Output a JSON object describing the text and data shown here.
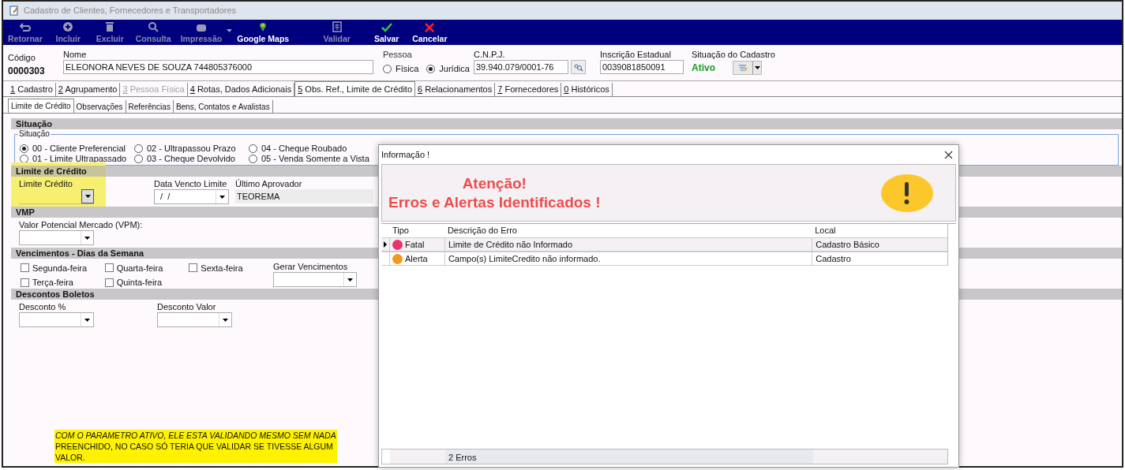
{
  "window": {
    "title": "Cadastro de Clientes, Fornecedores e Transportadores"
  },
  "toolbar": [
    {
      "label": "Retornar",
      "disabled": true
    },
    {
      "label": "Incluir",
      "disabled": true
    },
    {
      "label": "Excluir",
      "disabled": true
    },
    {
      "label": "Consulta",
      "disabled": true
    },
    {
      "label": "Impressão",
      "disabled": true,
      "dropdown": true
    },
    {
      "label": "Google Maps",
      "disabled": false
    },
    {
      "label": "Validar",
      "disabled": true
    },
    {
      "label": "Salvar",
      "disabled": false
    },
    {
      "label": "Cancelar",
      "disabled": false
    }
  ],
  "header": {
    "codigo": {
      "label": "Código",
      "value": "0000303"
    },
    "nome": {
      "label": "Nome",
      "value": "ELEONORA NEVES DE SOUZA 744805376000"
    },
    "pessoa": {
      "label": "Pessoa",
      "options": [
        {
          "label": "Física",
          "selected": false
        },
        {
          "label": "Jurídica",
          "selected": true
        }
      ]
    },
    "cnpj": {
      "label": "C.N.P.J.",
      "value": "39.940.079/0001-76"
    },
    "inscricao": {
      "label": "Inscrição Estadual",
      "value": "0039081850091"
    },
    "situacao": {
      "label": "Situação do Cadastro",
      "value": "Ativo"
    }
  },
  "tabs": [
    {
      "label": "1 Cadastro",
      "selected": false,
      "disabled": false
    },
    {
      "label": "2 Agrupamento",
      "selected": false,
      "disabled": false
    },
    {
      "label": "3 Pessoa Física",
      "selected": false,
      "disabled": true
    },
    {
      "label": "4 Rotas, Dados Adicionais",
      "selected": false,
      "disabled": false
    },
    {
      "label": "5 Obs. Ref., Limite de Crédito",
      "selected": true,
      "disabled": false
    },
    {
      "label": "6 Relacionamentos",
      "selected": false,
      "disabled": false
    },
    {
      "label": "7 Fornecedores",
      "selected": false,
      "disabled": false
    },
    {
      "label": "0 Históricos",
      "selected": false,
      "disabled": false
    }
  ],
  "subtabs": [
    {
      "label": "Limite de Crédito",
      "selected": true
    },
    {
      "label": "Observações",
      "selected": false
    },
    {
      "label": "Referências",
      "selected": false
    },
    {
      "label": "Bens, Contatos e Avalistas",
      "selected": false
    }
  ],
  "situacao": {
    "title": "Situação",
    "group": "Situação",
    "options": [
      {
        "label": "00 - Cliente Preferencial",
        "selected": true
      },
      {
        "label": "01 - Limite Ultrapassado",
        "selected": false
      },
      {
        "label": "02 - Ultrapassou Prazo",
        "selected": false
      },
      {
        "label": "03 - Cheque Devolvido",
        "selected": false
      },
      {
        "label": "04 - Cheque Roubado",
        "selected": false
      },
      {
        "label": "05 - Venda Somente a Vista",
        "selected": false
      }
    ]
  },
  "limite": {
    "title": "Limite de Crédito",
    "limite_credito": {
      "label": "Limite Crédito"
    },
    "data_vencto": {
      "label": "Data Vencto Limite",
      "value": " /  /"
    },
    "ultimo_aprovador": {
      "label": "Último Aprovador",
      "value": "TEOREMA"
    }
  },
  "vmp": {
    "title": "VMP",
    "vpm_label": "Valor Potencial Mercado (VPM):"
  },
  "vencimentos": {
    "title": "Vencimentos - Dias da Semana",
    "days": [
      {
        "label": "Segunda-feira",
        "checked": false
      },
      {
        "label": "Terça-feira",
        "checked": false
      },
      {
        "label": "Quarta-feira",
        "checked": false
      },
      {
        "label": "Quinta-feira",
        "checked": false
      },
      {
        "label": "Sexta-feira",
        "checked": false
      }
    ],
    "gerar_label": "Gerar Vencimentos"
  },
  "descontos": {
    "title": "Descontos Boletos",
    "fields": [
      "Desconto %",
      "Desconto Valor"
    ]
  },
  "note": "*COM O PARAMETRO ATIVO, ELE ESTA VALIDANDO MESMO SEM NADA* PREENCHIDO, NO CASO SÓ TERIA QUE VALIDAR SE TIVESSE ALGUM VALOR.",
  "dialog": {
    "title": "Informação !",
    "heading": [
      "Atenção!",
      "Erros e Alertas Identificados !"
    ],
    "columns": [
      "Tipo",
      "Descrição do Erro",
      "Local"
    ],
    "rows": [
      {
        "tipo": "Fatal",
        "color": "#e8336f",
        "descricao": "Limite de Crédito não Informado",
        "local": "Cadastro Básico",
        "selected": true
      },
      {
        "tipo": "Alerta",
        "color": "#f39a1c",
        "descricao": "Campo(s) LimiteCredito não informado.",
        "local": "Cadastro",
        "selected": false
      }
    ],
    "footer": "2 Erros"
  }
}
